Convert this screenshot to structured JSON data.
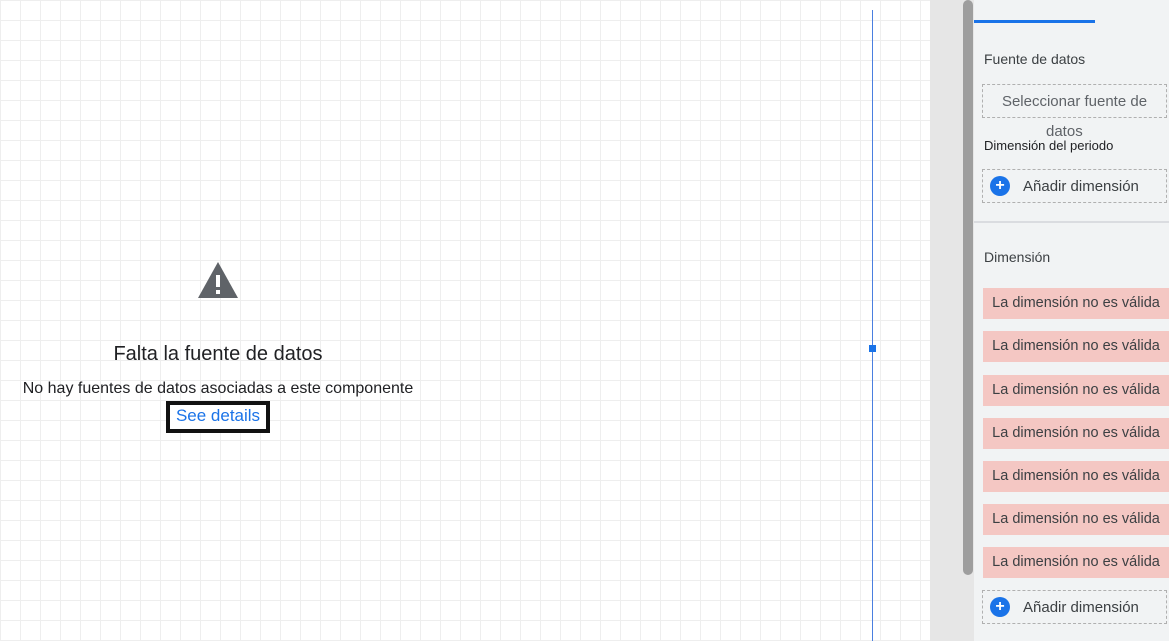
{
  "canvas": {
    "warning_icon": "warning-triangle-icon",
    "missing_title": "Falta la fuente de datos",
    "missing_message": "No hay fuentes de datos asociadas a este componente",
    "details_link": "See details"
  },
  "panel": {
    "data_source_label": "Fuente de datos",
    "data_source_button": "Seleccionar fuente de",
    "data_source_button_overflow": "datos",
    "period_dimension_label": "Dimensión del periodo",
    "add_dimension_label": "Añadir dimensión",
    "dimension_label": "Dimensión",
    "invalid_dimensions": [
      "La dimensión no es válida",
      "La dimensión no es válida",
      "La dimensión no es válida",
      "La dimensión no es válida",
      "La dimensión no es válida",
      "La dimensión no es válida",
      "La dimensión no es válida"
    ],
    "add_dimension_bottom_label": "Añadir dimensión"
  },
  "colors": {
    "accent": "#1a73e8",
    "invalid_chip": "#f4c7c3",
    "panel_bg": "#f1f3f4"
  }
}
